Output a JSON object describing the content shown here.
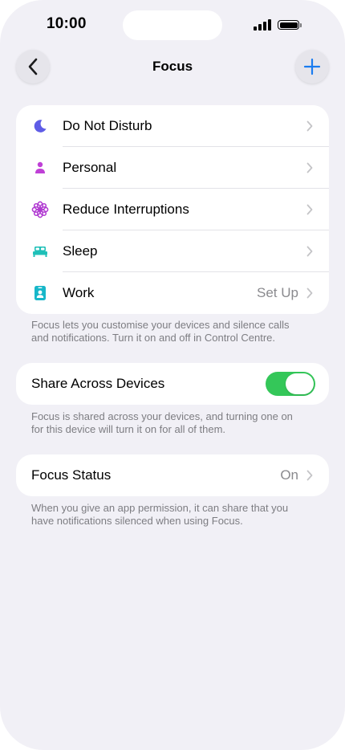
{
  "status_bar": {
    "time": "10:00"
  },
  "nav": {
    "title": "Focus",
    "back_icon": "chevron-left-icon",
    "add_icon": "plus-icon"
  },
  "focus_modes": [
    {
      "label": "Do Not Disturb",
      "icon": "moon-icon",
      "color": "#5e5ce6",
      "value": ""
    },
    {
      "label": "Personal",
      "icon": "person-icon",
      "color": "#bf40d6",
      "value": ""
    },
    {
      "label": "Reduce Interruptions",
      "icon": "flower-icon",
      "color": "#b03ad1",
      "value": ""
    },
    {
      "label": "Sleep",
      "icon": "bed-icon",
      "color": "#1fc0b8",
      "value": ""
    },
    {
      "label": "Work",
      "icon": "id-badge-icon",
      "color": "#17b7c9",
      "value": "Set Up"
    }
  ],
  "focus_footnote": "Focus lets you customise your devices and silence calls and notifications. Turn it on and off in Control Centre.",
  "share": {
    "label": "Share Across Devices",
    "enabled": true,
    "color": "#34c759"
  },
  "share_footnote": "Focus is shared across your devices, and turning one on for this device will turn it on for all of them.",
  "focus_status": {
    "label": "Focus Status",
    "value": "On"
  },
  "status_footnote": "When you give an app permission, it can share that you have notifications silenced when using Focus."
}
